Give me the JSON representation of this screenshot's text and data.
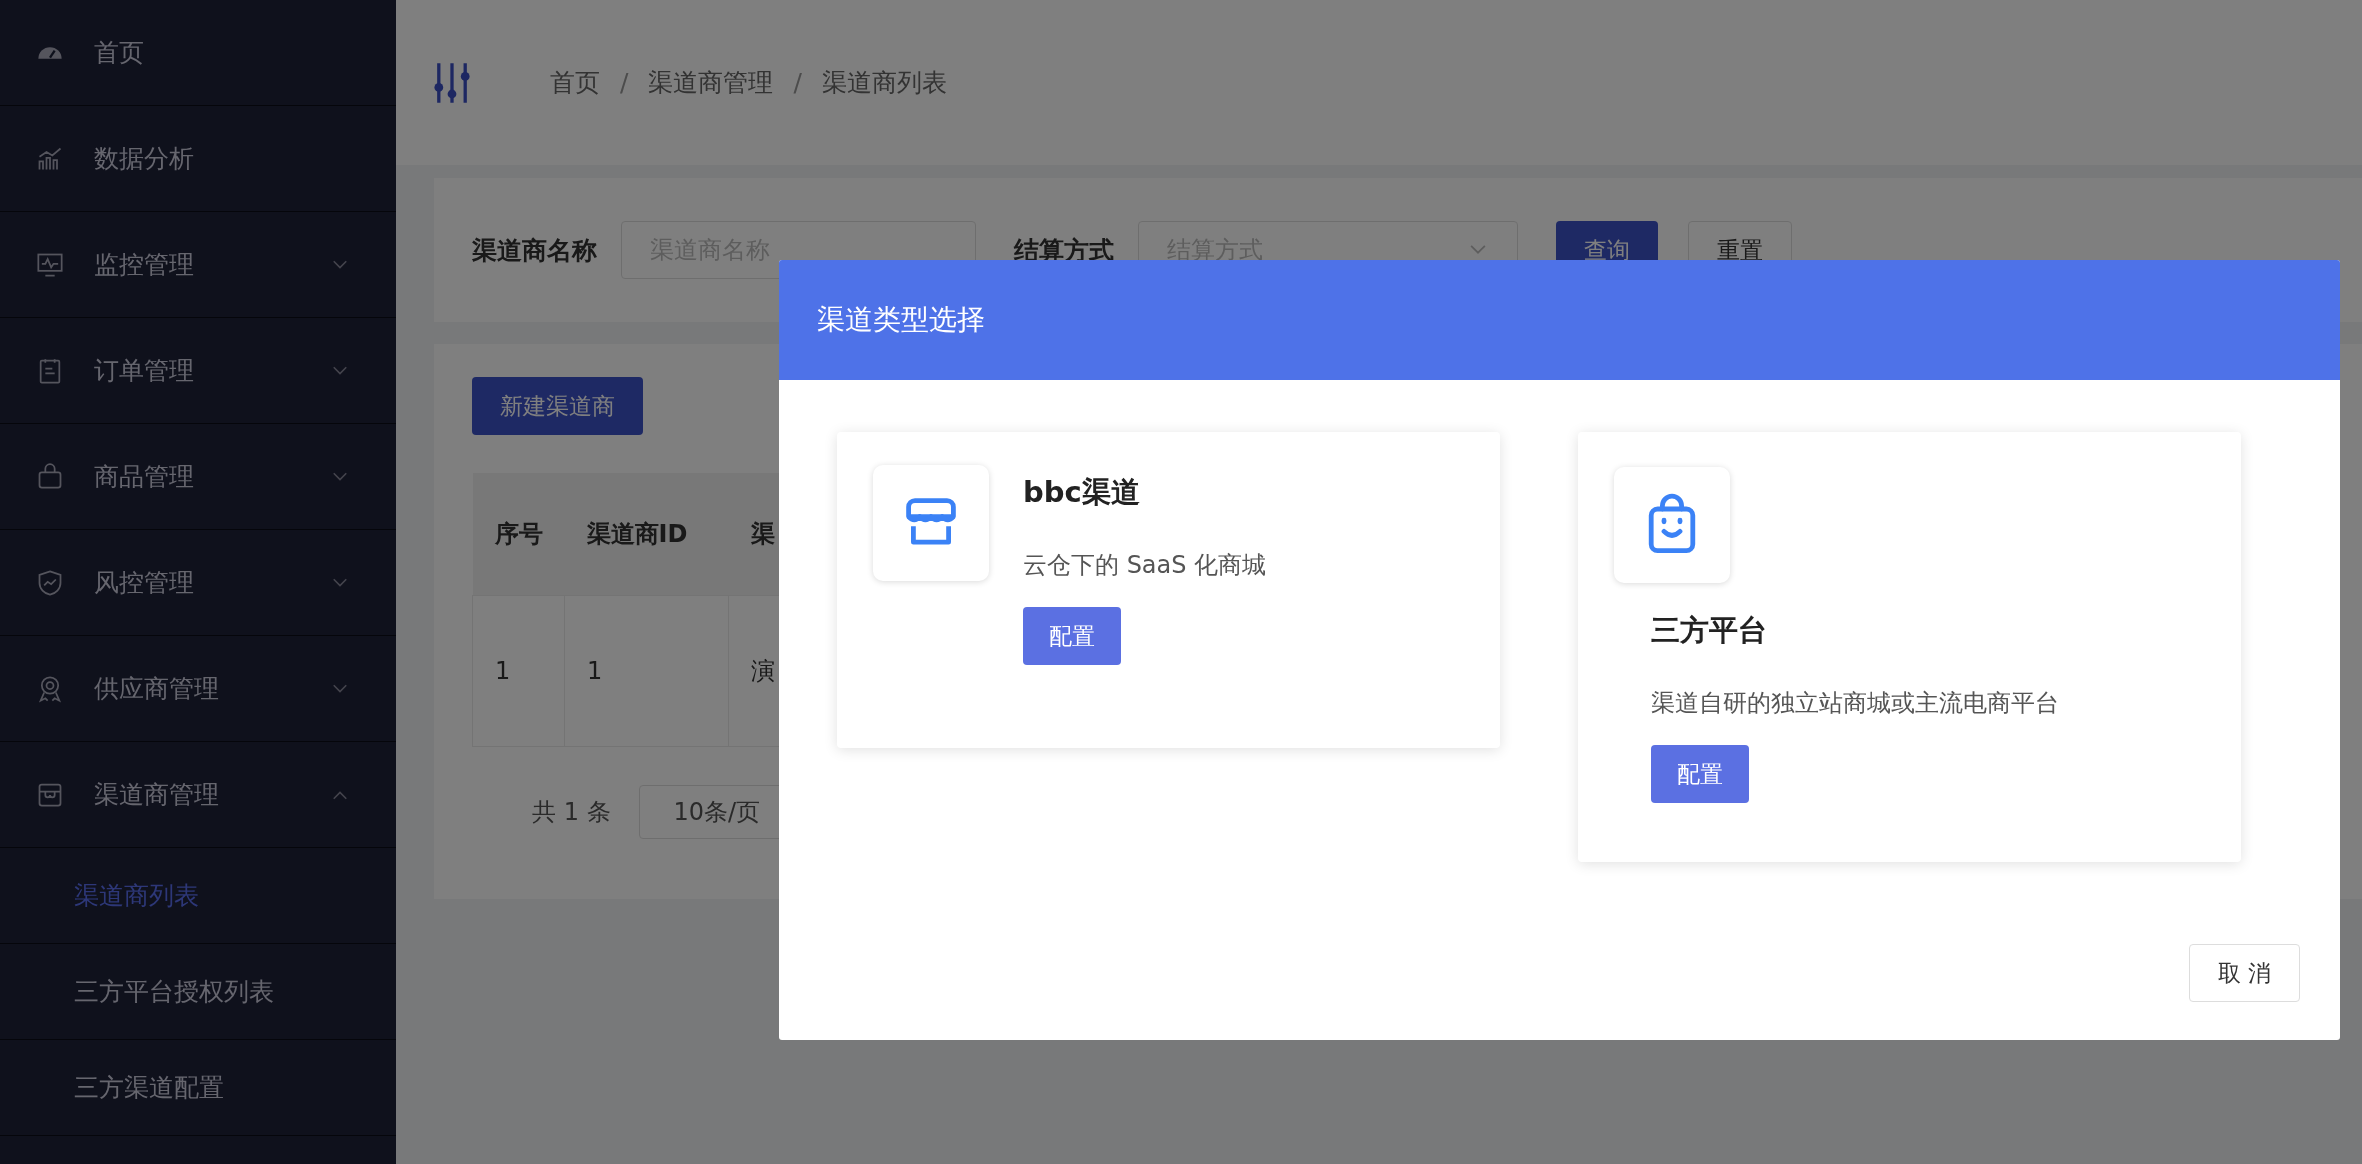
{
  "sidebar": {
    "items": [
      {
        "kind": "link",
        "label": "首页"
      },
      {
        "kind": "link",
        "label": "数据分析"
      },
      {
        "kind": "group",
        "label": "监控管理",
        "expanded": false
      },
      {
        "kind": "group",
        "label": "订单管理",
        "expanded": false
      },
      {
        "kind": "group",
        "label": "商品管理",
        "expanded": false
      },
      {
        "kind": "group",
        "label": "风控管理",
        "expanded": false
      },
      {
        "kind": "group",
        "label": "供应商管理",
        "expanded": false
      },
      {
        "kind": "group",
        "label": "渠道商管理",
        "expanded": true,
        "children": [
          {
            "label": "渠道商列表",
            "selected": true
          },
          {
            "label": "三方平台授权列表",
            "selected": false
          },
          {
            "label": "三方渠道配置",
            "selected": false
          }
        ]
      }
    ]
  },
  "header": {
    "breadcrumb": [
      "首页",
      "渠道商管理",
      "渠道商列表"
    ],
    "separator": "/"
  },
  "filters": [
    {
      "kind": "input",
      "label": "渠道商名称",
      "placeholder": "渠道商名称"
    },
    {
      "kind": "select",
      "label": "结算方式",
      "placeholder": "结算方式"
    }
  ],
  "filter_buttons": [
    {
      "label": "查询",
      "primary": true
    },
    {
      "label": "重置",
      "primary": false
    }
  ],
  "new_button": "新建渠道商",
  "table": {
    "columns": [
      "序号",
      "渠道商ID",
      "渠"
    ],
    "rows": [
      [
        "1",
        "1",
        "演"
      ]
    ]
  },
  "pagination": {
    "total": "共 1 条",
    "page_size": "10条/页"
  },
  "dialog": {
    "title": "渠道类型选择",
    "options": [
      {
        "kind": "side",
        "title": "bbc渠道",
        "description": "云仓下的 SaaS 化商城",
        "button": "配置"
      },
      {
        "kind": "stacked",
        "title": "三方平台",
        "description": "渠道自研的独立站商城或主流电商平台",
        "button": "配置"
      }
    ],
    "cancel": "取 消"
  }
}
